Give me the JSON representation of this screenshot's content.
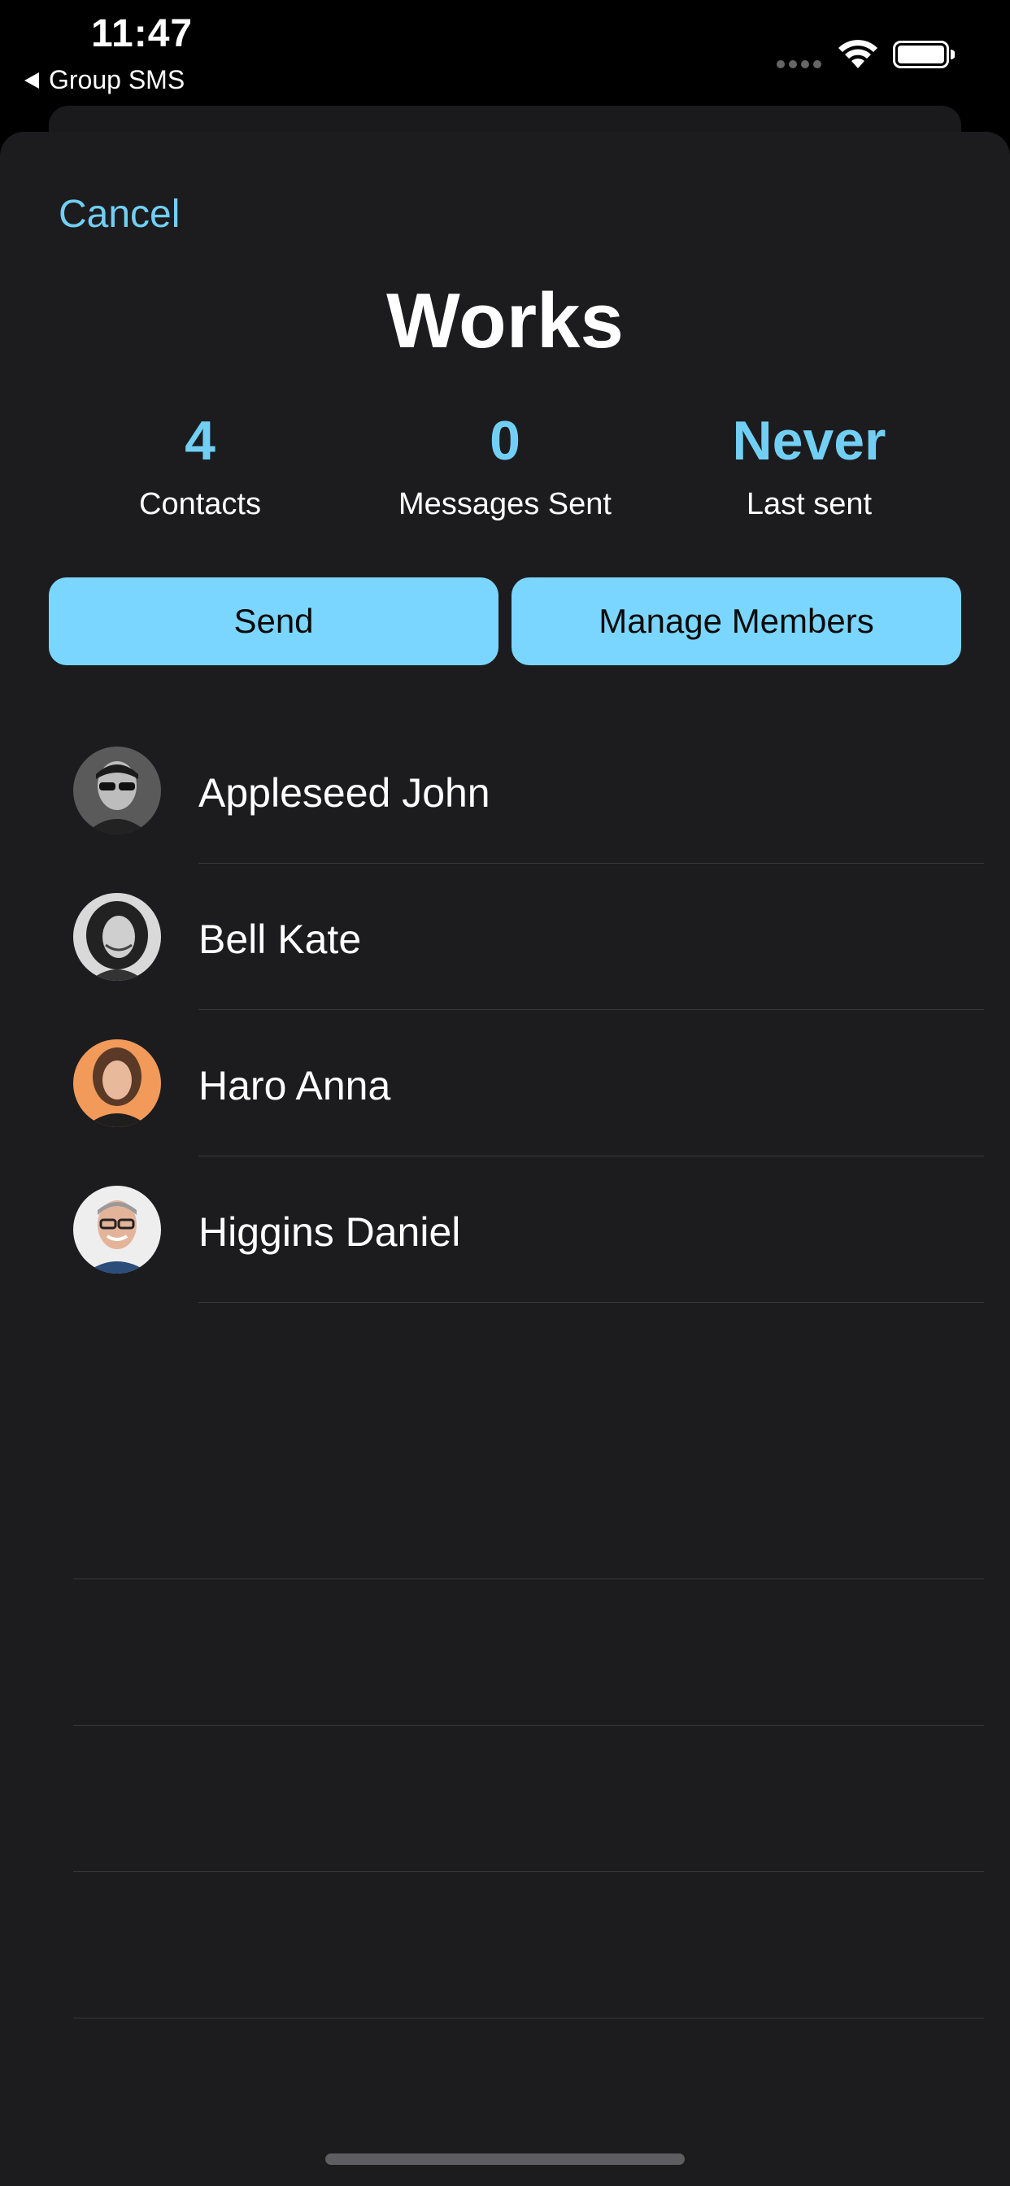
{
  "status_bar": {
    "time": "11:47",
    "back_app_label": "Group SMS"
  },
  "sheet": {
    "cancel_label": "Cancel",
    "title": "Works",
    "stats": {
      "contacts_value": "4",
      "contacts_label": "Contacts",
      "messages_value": "0",
      "messages_label": "Messages Sent",
      "last_value": "Never",
      "last_label": "Last sent"
    },
    "send_label": "Send",
    "manage_label": "Manage Members",
    "members": [
      {
        "name": "Appleseed John"
      },
      {
        "name": "Bell Kate"
      },
      {
        "name": "Haro Anna"
      },
      {
        "name": "Higgins Daniel"
      }
    ]
  },
  "colors": {
    "accent": "#72cff4",
    "button_bg": "#7bd6ff",
    "sheet_bg": "#1c1c1e",
    "separator": "#38383a"
  }
}
